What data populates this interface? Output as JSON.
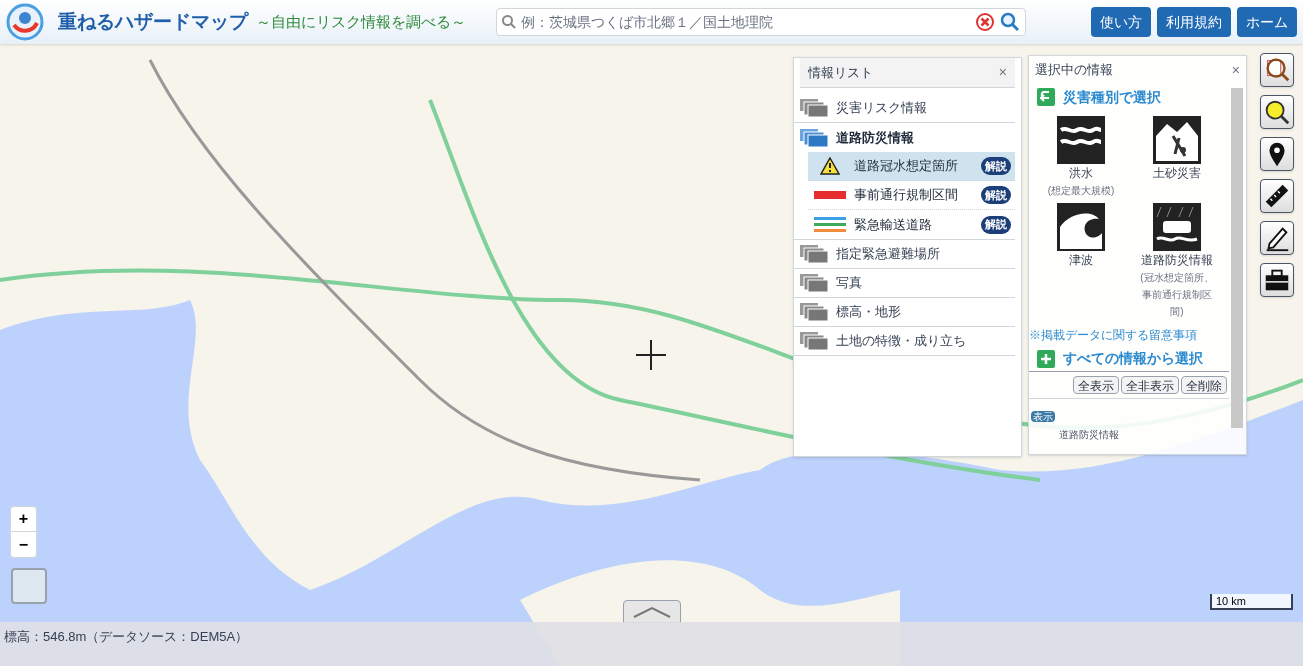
{
  "header": {
    "title": "重ねるハザードマップ",
    "subtitle": "～自由にリスク情報を調べる～",
    "search": {
      "placeholder": "例：茨城県つくば市北郷１／国土地理院"
    },
    "buttons": [
      "使い方",
      "利用規約",
      "ホーム"
    ]
  },
  "info_list": {
    "title": "情報リスト",
    "close": "×",
    "items": [
      {
        "label": "災害リスク情報",
        "expanded": false
      },
      {
        "label": "道路防災情報",
        "expanded": true,
        "children": [
          {
            "label": "道路冠水想定箇所",
            "kind": "warning",
            "selected": true,
            "button": "解説"
          },
          {
            "label": "事前通行規制区間",
            "kind": "red-line",
            "selected": false,
            "button": "解説"
          },
          {
            "label": "緊急輸送道路",
            "kind": "multi-line",
            "selected": false,
            "button": "解説"
          }
        ]
      },
      {
        "label": "指定緊急避難場所",
        "expanded": false
      },
      {
        "label": "写真",
        "expanded": false
      },
      {
        "label": "標高・地形",
        "expanded": false
      },
      {
        "label": "土地の特徴・成り立ち",
        "expanded": false
      }
    ]
  },
  "selected_panel": {
    "title": "選択中の情報",
    "close": "×",
    "section_1": "災害種別で選択",
    "hazards": [
      {
        "label": "洪水",
        "note": "(想定最大規模)",
        "kind": "flood"
      },
      {
        "label": "土砂災害",
        "kind": "landslide"
      },
      {
        "label": "津波",
        "kind": "tsunami"
      },
      {
        "label": "道路防災情報",
        "note": "(冠水想定箇所、事前通行規制区間)",
        "kind": "road"
      }
    ],
    "notice": "※掲載データに関する留意事項",
    "section_2": "すべての情報から選択",
    "buttons": [
      "全表示",
      "全非表示",
      "全削除"
    ],
    "badge": "表示",
    "layer": "道路防災情報"
  },
  "tools": [
    {
      "kind": "map-search"
    },
    {
      "kind": "hazard-search"
    },
    {
      "kind": "pin"
    },
    {
      "kind": "ruler"
    },
    {
      "kind": "pencil"
    },
    {
      "kind": "toolbox"
    }
  ],
  "zoom": {
    "in": "+",
    "out": "−"
  },
  "status_bar": "標高：546.8m（データソース：DEM5A）",
  "scale": "10 km"
}
